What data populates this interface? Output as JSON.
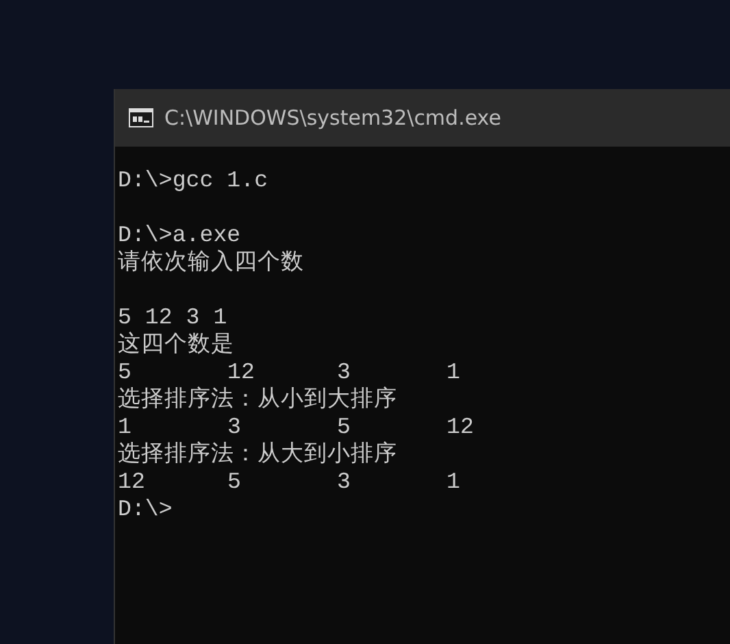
{
  "window": {
    "title": "C:\\WINDOWS\\system32\\cmd.exe"
  },
  "console": [
    {
      "kind": "text",
      "text": "D:\\>gcc 1.c"
    },
    {
      "kind": "blank"
    },
    {
      "kind": "text",
      "text": "D:\\>a.exe"
    },
    {
      "kind": "text",
      "text": "请依次输入四个数"
    },
    {
      "kind": "blank"
    },
    {
      "kind": "text",
      "text": "5 12 3 1"
    },
    {
      "kind": "text",
      "text": "这四个数是"
    },
    {
      "kind": "columns",
      "cells": [
        "5",
        "12",
        "3",
        "1"
      ]
    },
    {
      "kind": "text",
      "text": "选择排序法：从小到大排序"
    },
    {
      "kind": "columns",
      "cells": [
        "1",
        "3",
        "5",
        "12"
      ]
    },
    {
      "kind": "text",
      "text": "选择排序法：从大到小排序"
    },
    {
      "kind": "columns",
      "cells": [
        "12",
        "5",
        "3",
        "1"
      ]
    },
    {
      "kind": "text",
      "text": "D:\\>"
    }
  ]
}
